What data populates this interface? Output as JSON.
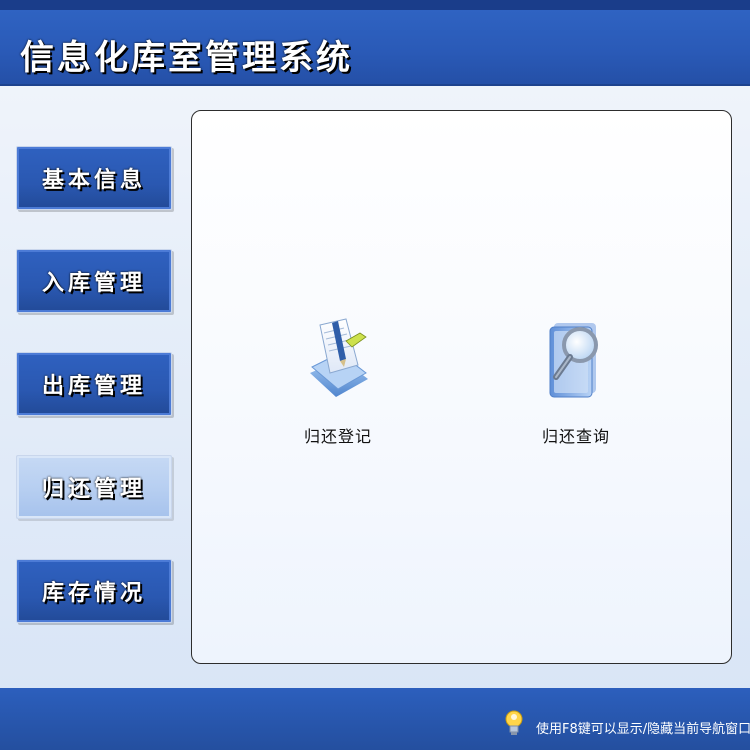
{
  "app": {
    "title": "信息化库室管理系统"
  },
  "sidebar": {
    "items": [
      {
        "label": "基本信息",
        "active": false
      },
      {
        "label": "入库管理",
        "active": false
      },
      {
        "label": "出库管理",
        "active": false
      },
      {
        "label": "归还管理",
        "active": true
      },
      {
        "label": "库存情况",
        "active": false
      }
    ]
  },
  "main": {
    "actions": [
      {
        "label": "归还登记",
        "icon": "register-document-pencil-icon"
      },
      {
        "label": "归还查询",
        "icon": "search-magnifier-icon"
      }
    ]
  },
  "footer": {
    "hint": "使用F8键可以显示/隐藏当前导航窗口",
    "icon": "lightbulb-user-icon"
  },
  "colors": {
    "header_blue": "#2a5ab7",
    "nav_blue": "#2a58b1",
    "nav_active": "#b6cef1",
    "panel_border": "#2d2d2d"
  }
}
